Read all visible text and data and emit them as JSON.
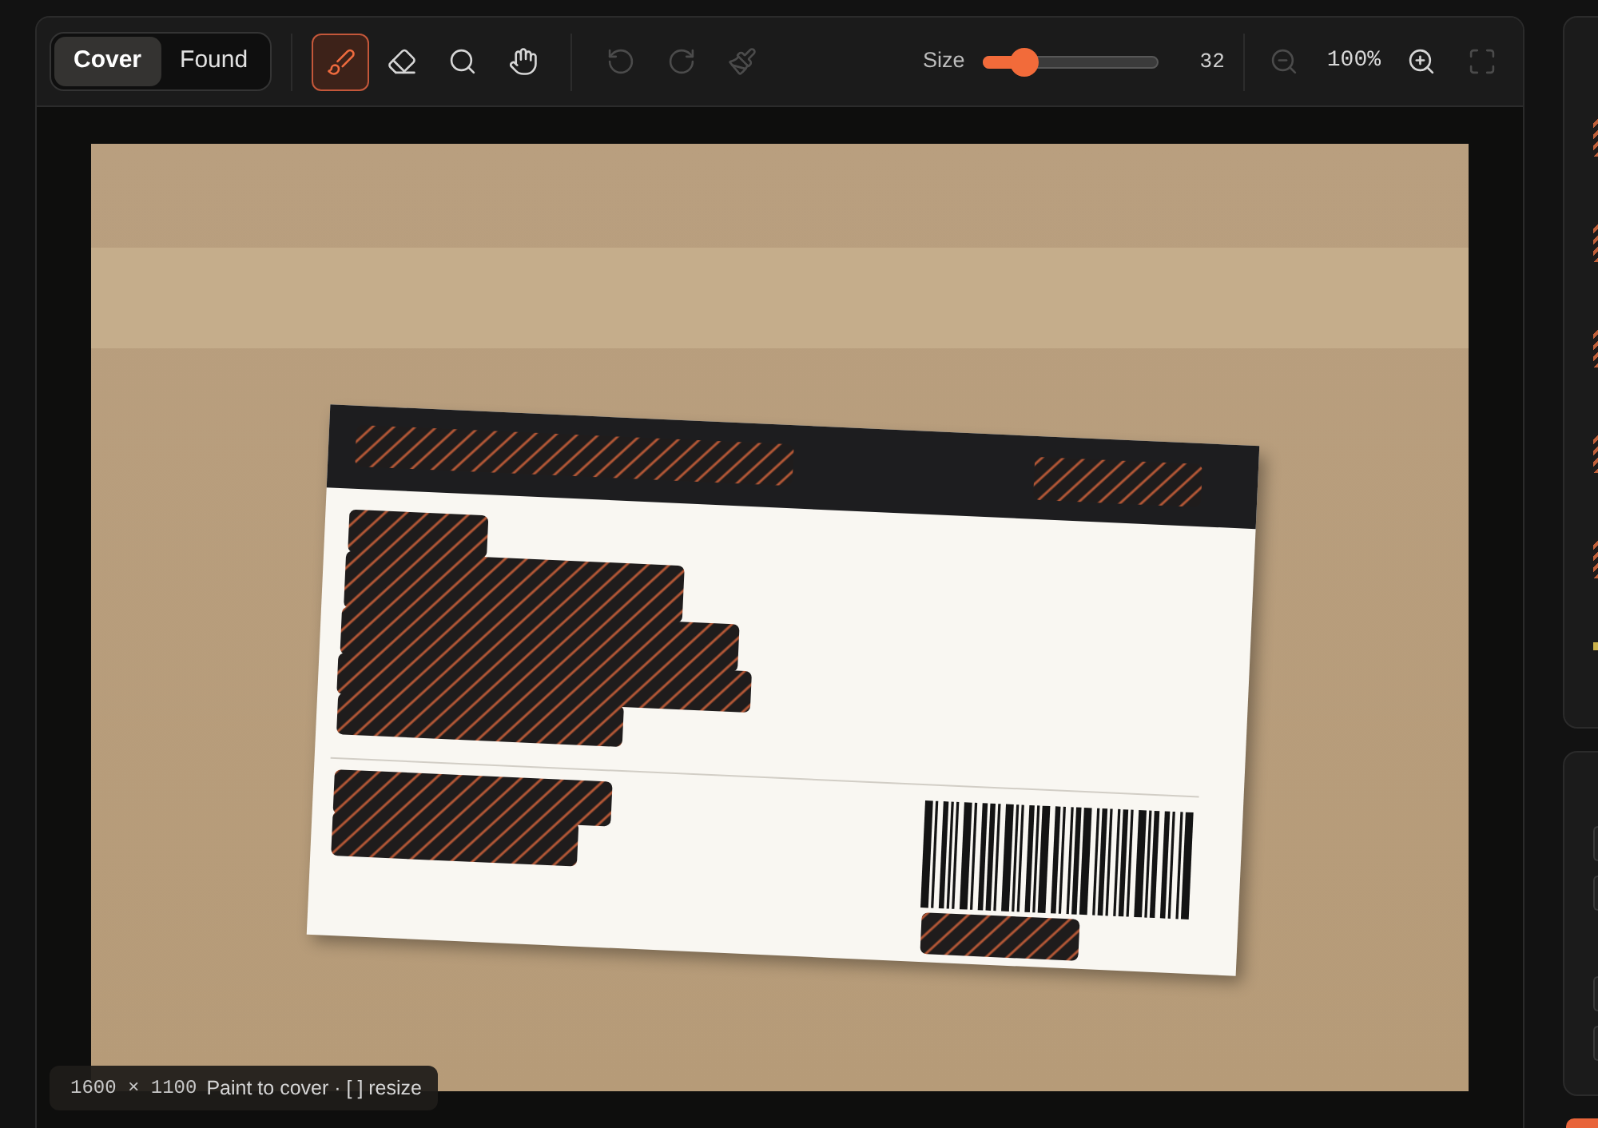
{
  "modes": [
    {
      "label": "Cover",
      "selected": true
    },
    {
      "label": "Found",
      "selected": false
    }
  ],
  "tools": [
    {
      "kind": "brush",
      "selected": true
    },
    {
      "kind": "eraser",
      "selected": false
    },
    {
      "kind": "zoom",
      "selected": false
    },
    {
      "kind": "pan",
      "selected": false
    }
  ],
  "history": [
    {
      "kind": "undo",
      "disabled": true
    },
    {
      "kind": "redo",
      "disabled": true
    },
    {
      "kind": "clear",
      "disabled": true
    }
  ],
  "brush_size": {
    "label": "Size",
    "level": 0.19,
    "value": "32"
  },
  "zoom": {
    "value": "100%",
    "buttons": [
      {
        "kind": "zoom_out",
        "disabled": true
      },
      {
        "kind": "zoom_in",
        "disabled": false
      },
      {
        "kind": "fit",
        "disabled": true
      }
    ]
  },
  "status": {
    "dimensions": "1600 × 1100",
    "hint": "Paint to cover · [ ] resize"
  }
}
